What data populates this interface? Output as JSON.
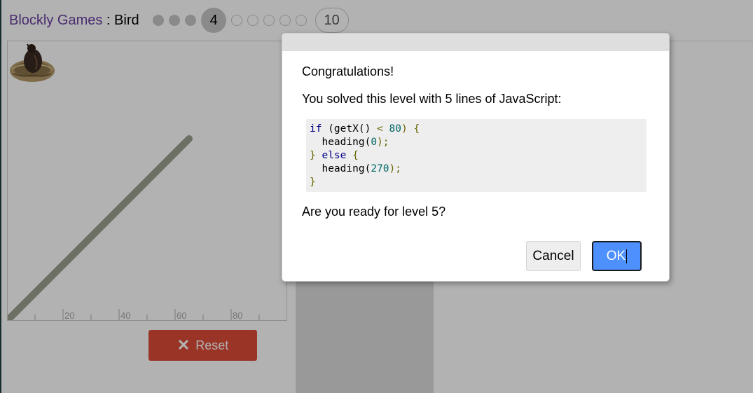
{
  "header": {
    "app_name": "Blockly Games",
    "separator": " : ",
    "game_name": "Bird",
    "current_level": "4",
    "last_level": "10"
  },
  "stage": {
    "ticks": [
      "20",
      "40",
      "60",
      "80"
    ]
  },
  "reset_button": {
    "label": "Reset",
    "icon": "close-icon"
  },
  "dialog": {
    "title": "Congratulations!",
    "message": "You solved this level with 5 lines of JavaScript:",
    "code": [
      [
        {
          "t": "if",
          "c": "kw"
        },
        {
          "t": " (getX() ",
          "c": ""
        },
        {
          "t": "<",
          "c": "pun"
        },
        {
          "t": " ",
          "c": ""
        },
        {
          "t": "80",
          "c": "num"
        },
        {
          "t": ") {",
          "c": "pun"
        }
      ],
      [
        {
          "t": "  heading(",
          "c": ""
        },
        {
          "t": "0",
          "c": "num"
        },
        {
          "t": ");",
          "c": "pun"
        }
      ],
      [
        {
          "t": "} ",
          "c": "pun"
        },
        {
          "t": "else",
          "c": "kw"
        },
        {
          "t": " {",
          "c": "pun"
        }
      ],
      [
        {
          "t": "  heading(",
          "c": ""
        },
        {
          "t": "270",
          "c": "num"
        },
        {
          "t": ");",
          "c": "pun"
        }
      ],
      [
        {
          "t": "}",
          "c": "pun"
        }
      ]
    ],
    "question": "Are you ready for level 5?",
    "cancel_label": "Cancel",
    "ok_label": "OK"
  },
  "colors": {
    "accent": "#4d90fe",
    "reset": "#dd4b39",
    "app_name": "#6a3fa0",
    "wall": "#9aa090"
  }
}
